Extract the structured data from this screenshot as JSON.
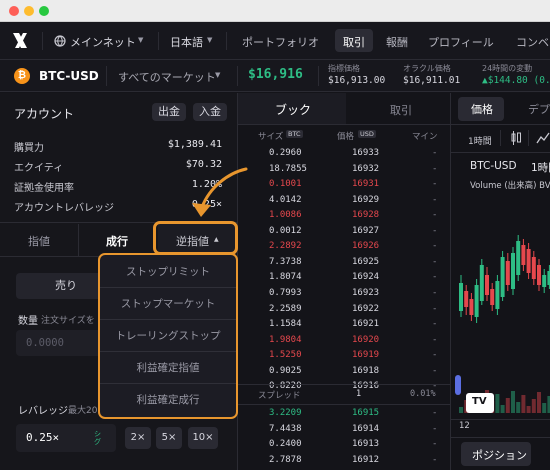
{
  "window": {
    "traffic_lights": [
      "#fe5f57",
      "#febc2e",
      "#28c840"
    ]
  },
  "nav": {
    "network": "メインネット",
    "language": "日本語",
    "portfolio": "ポートフォリオ",
    "trade": "取引",
    "rewards": "報酬",
    "profile": "プロフィール",
    "community": "コンベ"
  },
  "market": {
    "symbol": "BTC-USD",
    "all_markets": "すべてのマーケット",
    "price": "$16,916",
    "index_label": "指標価格",
    "index_value": "$16,913.00",
    "oracle_label": "オラクル価格",
    "oracle_value": "$16,911.01",
    "change_label": "24時間の変動",
    "change_value": "▲$144.80 (0.8"
  },
  "account": {
    "title": "アカウント",
    "withdraw": "出金",
    "deposit": "入金",
    "rows": [
      {
        "label": "購買力",
        "value": "$1,389.41"
      },
      {
        "label": "エクイティ",
        "value": "$70.32"
      },
      {
        "label": "証拠金使用率",
        "value": "1.20%"
      },
      {
        "label": "アカウントレバレッジ",
        "value": "0.25×"
      }
    ]
  },
  "order": {
    "tabs": [
      "指値",
      "成行",
      "逆指値"
    ],
    "stop_caret": "▲",
    "sell": "売り",
    "qty_label": "数量",
    "qty_hint": "注文サイズを",
    "qty_placeholder": "0.0000",
    "leverage_label": "レバレッジ",
    "leverage_max": "最大20",
    "leverage_value": "0.25×",
    "lev_side": "シグ",
    "lev_buttons": [
      "2×",
      "5×",
      "10×"
    ]
  },
  "stop_menu": [
    "ストップリミット",
    "ストップマーケット",
    "トレーリングストップ",
    "利益確定指値",
    "利益確定成行"
  ],
  "orderbook": {
    "tab_book": "ブック",
    "tab_trades": "取引",
    "col_size": "サイズ",
    "col_size_badge": "BTC",
    "col_price": "価格",
    "col_price_badge": "USD",
    "col_mine": "マイン",
    "asks": [
      {
        "size": "0.2960",
        "price": "16933",
        "mine": "-",
        "hl": false
      },
      {
        "size": "18.7855",
        "price": "16932",
        "mine": "-",
        "hl": false
      },
      {
        "size": "0.1001",
        "price": "16931",
        "mine": "-",
        "hl": true
      },
      {
        "size": "4.0142",
        "price": "16929",
        "mine": "-",
        "hl": false
      },
      {
        "size": "1.0086",
        "price": "16928",
        "mine": "-",
        "hl": true
      },
      {
        "size": "0.0012",
        "price": "16927",
        "mine": "-",
        "hl": false
      },
      {
        "size": "2.2892",
        "price": "16926",
        "mine": "-",
        "hl": true
      },
      {
        "size": "7.3738",
        "price": "16925",
        "mine": "-",
        "hl": false
      },
      {
        "size": "1.8074",
        "price": "16924",
        "mine": "-",
        "hl": false
      },
      {
        "size": "0.7993",
        "price": "16923",
        "mine": "-",
        "hl": false
      },
      {
        "size": "2.2589",
        "price": "16922",
        "mine": "-",
        "hl": false
      },
      {
        "size": "1.1584",
        "price": "16921",
        "mine": "-",
        "hl": false
      },
      {
        "size": "1.9804",
        "price": "16920",
        "mine": "-",
        "hl": true
      },
      {
        "size": "1.5250",
        "price": "16919",
        "mine": "-",
        "hl": true
      },
      {
        "size": "0.9025",
        "price": "16918",
        "mine": "-",
        "hl": false
      },
      {
        "size": "0.8220",
        "price": "16916",
        "mine": "-",
        "hl": false
      }
    ],
    "spread_label": "スプレッド",
    "spread_value": "1",
    "spread_pct": "0.01%",
    "bids": [
      {
        "size": "3.2209",
        "price": "16915",
        "mine": "-",
        "hl": true
      },
      {
        "size": "7.4438",
        "price": "16914",
        "mine": "-",
        "hl": false
      },
      {
        "size": "0.2400",
        "price": "16913",
        "mine": "-",
        "hl": false
      },
      {
        "size": "2.7878",
        "price": "16912",
        "mine": "-",
        "hl": false
      }
    ]
  },
  "chart": {
    "tab_price": "価格",
    "tab_depth": "デプ",
    "interval": "1時間",
    "symbol": "BTC-USD",
    "interval_title": "1時間",
    "volume": "Volume (出来高) BV",
    "axis_label": "12",
    "logo": "TV",
    "positions": "ポジション"
  },
  "colors": {
    "accent": "#e8962e",
    "green": "#2ebd85",
    "red": "#e5484d"
  }
}
